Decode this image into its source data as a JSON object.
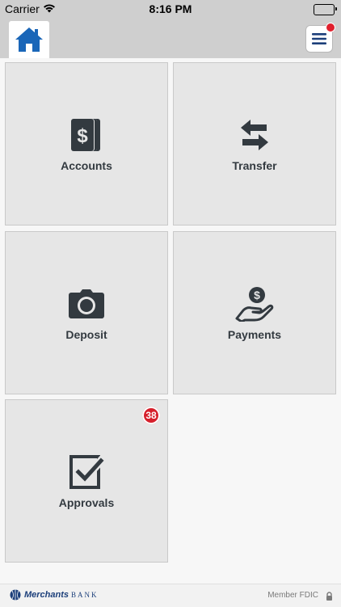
{
  "status_bar": {
    "carrier": "Carrier",
    "time": "8:16 PM"
  },
  "nav": {
    "home_icon": "home-icon",
    "menu_icon": "hamburger-menu-icon",
    "notification": true
  },
  "colors": {
    "home_blue": "#1a66b8",
    "icon_dark": "#333a40",
    "badge_red": "#d61f2b",
    "brand_blue": "#1c3f7a"
  },
  "tiles": [
    {
      "label": "Accounts",
      "icon": "dollar-cards-icon"
    },
    {
      "label": "Transfer",
      "icon": "transfer-arrows-icon"
    },
    {
      "label": "Deposit",
      "icon": "camera-icon"
    },
    {
      "label": "Payments",
      "icon": "hand-dollar-icon"
    },
    {
      "label": "Approvals",
      "icon": "checklist-icon",
      "badge": "38"
    }
  ],
  "footer": {
    "brand_name": "Merchants",
    "brand_suffix": "BANK",
    "member_text": "Member FDIC"
  }
}
